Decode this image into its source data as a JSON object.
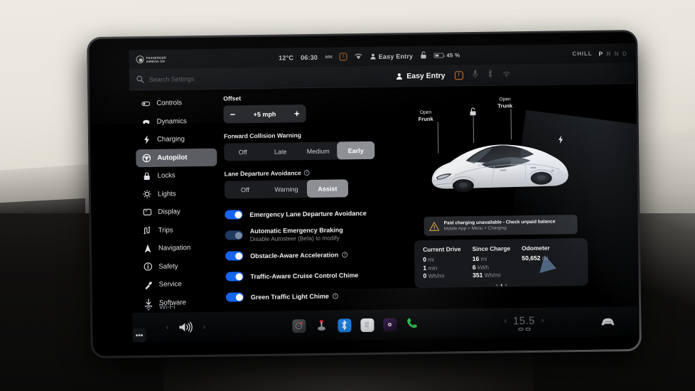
{
  "status_bar": {
    "airbag_line1": "PASSENGER",
    "airbag_line2": "AIRBAG ON",
    "temperature": "12°C",
    "time": "06:30",
    "sos_label": "sos",
    "alert_icon": "alert-clock-icon",
    "wifi_icon": "wifi-icon",
    "profile_label": "Easy Entry",
    "lock_icon": "unlock-icon",
    "battery_percent": "45 %",
    "battery_level": 45,
    "drive_mode": "CHILL",
    "gear_p": "P",
    "gear_rnd": " R N D",
    "headlight_icon": "headlight-low-beam-icon",
    "headlight_auto_icon": "headlight-auto-icon"
  },
  "search_row": {
    "placeholder": "Search Settings",
    "search_icon": "search-icon",
    "profile_label": "Easy Entry",
    "alert_icon": "alert-clock-icon",
    "mic_icon": "microphone-icon",
    "bluetooth_icon": "bluetooth-icon",
    "wifi_icon": "wifi-icon"
  },
  "sidebar": {
    "items": [
      {
        "label": "Controls",
        "icon": "controls-icon",
        "active": false
      },
      {
        "label": "Dynamics",
        "icon": "car-dynamics-icon",
        "active": false
      },
      {
        "label": "Charging",
        "icon": "bolt-icon",
        "active": false
      },
      {
        "label": "Autopilot",
        "icon": "steering-wheel-icon",
        "active": true
      },
      {
        "label": "Locks",
        "icon": "padlock-icon",
        "active": false
      },
      {
        "label": "Lights",
        "icon": "lightbulb-icon",
        "active": false
      },
      {
        "label": "Display",
        "icon": "display-icon",
        "active": false
      },
      {
        "label": "Trips",
        "icon": "trips-icon",
        "active": false
      },
      {
        "label": "Navigation",
        "icon": "navigation-arrow-icon",
        "active": false
      },
      {
        "label": "Safety",
        "icon": "info-circle-icon",
        "active": false
      },
      {
        "label": "Service",
        "icon": "wrench-icon",
        "active": false
      },
      {
        "label": "Software",
        "icon": "download-icon",
        "active": false
      }
    ],
    "wifi_row": {
      "label": "Wi-Fi",
      "icon": "wifi-icon"
    }
  },
  "settings": {
    "offset": {
      "label": "Offset",
      "value": "+5 mph",
      "minus": "−",
      "plus": "+"
    },
    "forward_collision_warning": {
      "label": "Forward Collision Warning",
      "options": [
        "Off",
        "Late",
        "Medium",
        "Early"
      ],
      "selected": "Early"
    },
    "lane_departure_avoidance": {
      "label": "Lane Departure Avoidance",
      "info_icon": "info-circle-icon",
      "options": [
        "Off",
        "Warning",
        "Assist"
      ],
      "selected": "Assist"
    },
    "toggles": [
      {
        "label": "Emergency Lane Departure Avoidance",
        "sub": "",
        "on": true,
        "disabled": false,
        "info": false
      },
      {
        "label": "Automatic Emergency Braking",
        "sub": "Disable Autosteer (Beta) to modify",
        "on": true,
        "disabled": true,
        "info": false
      },
      {
        "label": "Obstacle-Aware Acceleration",
        "sub": "",
        "on": true,
        "disabled": false,
        "info": true
      },
      {
        "label": "Traffic-Aware Cruise Control Chime",
        "sub": "",
        "on": true,
        "disabled": false,
        "info": false
      },
      {
        "label": "Green Traffic Light Chime",
        "sub": "",
        "on": true,
        "disabled": false,
        "info": true
      }
    ]
  },
  "car_panel": {
    "frunk": {
      "line1": "Open",
      "line2": "Frunk"
    },
    "trunk": {
      "line1": "Open",
      "line2": "Trunk"
    },
    "lock_icon": "unlock-icon",
    "charge_port_icon": "charge-bolt-icon",
    "vehicle_image": "tesla-model-3-white"
  },
  "notification": {
    "icon": "warning-triangle-icon",
    "title": "Paid charging unavailable - Check unpaid balance",
    "subtitle": "Mobile App > Menu > Charging"
  },
  "trip_card": {
    "columns": [
      {
        "header": "Current Drive",
        "rows": [
          {
            "value": "0",
            "unit": "mi"
          },
          {
            "value": "1",
            "unit": "min"
          },
          {
            "value": "0",
            "unit": "Wh/mi"
          }
        ]
      },
      {
        "header": "Since Charge",
        "rows": [
          {
            "value": "16",
            "unit": "mi"
          },
          {
            "value": "6",
            "unit": "kWh"
          },
          {
            "value": "351",
            "unit": "Wh/mi"
          }
        ]
      },
      {
        "header": "Odometer",
        "rows": [
          {
            "value": "50,652",
            "unit": "mi"
          }
        ]
      }
    ],
    "page_dots": 3,
    "active_dot": 1
  },
  "dock": {
    "volume_icon": "speaker-volume-icon",
    "prev_icon": "chevron-left-icon",
    "next_icon": "chevron-right-icon",
    "apps": [
      {
        "name": "camera-app-icon",
        "glyph": "◉"
      },
      {
        "name": "arcade-app-icon",
        "glyph": ""
      },
      {
        "name": "more-apps-icon",
        "glyph": "•••"
      },
      {
        "name": "bluetooth-app-icon",
        "glyph": ""
      },
      {
        "name": "notes-app-icon",
        "glyph": ""
      },
      {
        "name": "media-app-icon",
        "glyph": ""
      },
      {
        "name": "phone-app-icon",
        "glyph": ""
      }
    ],
    "climate": {
      "temperature": "15.5",
      "prev_icon": "chevron-left-icon",
      "next_icon": "chevron-right-icon",
      "seat_heater_left": "seat-heater-icon",
      "seat_heater_right": "seat-heater-icon"
    },
    "car_icon": "car-front-icon"
  },
  "colors": {
    "accent_blue": "#1565f0",
    "selected_gray": "#8e9096",
    "alert_orange": "#e07b2a",
    "gear_green": "#32c85a",
    "panel_bg": "#17191c",
    "screen_bg": "#000000"
  }
}
